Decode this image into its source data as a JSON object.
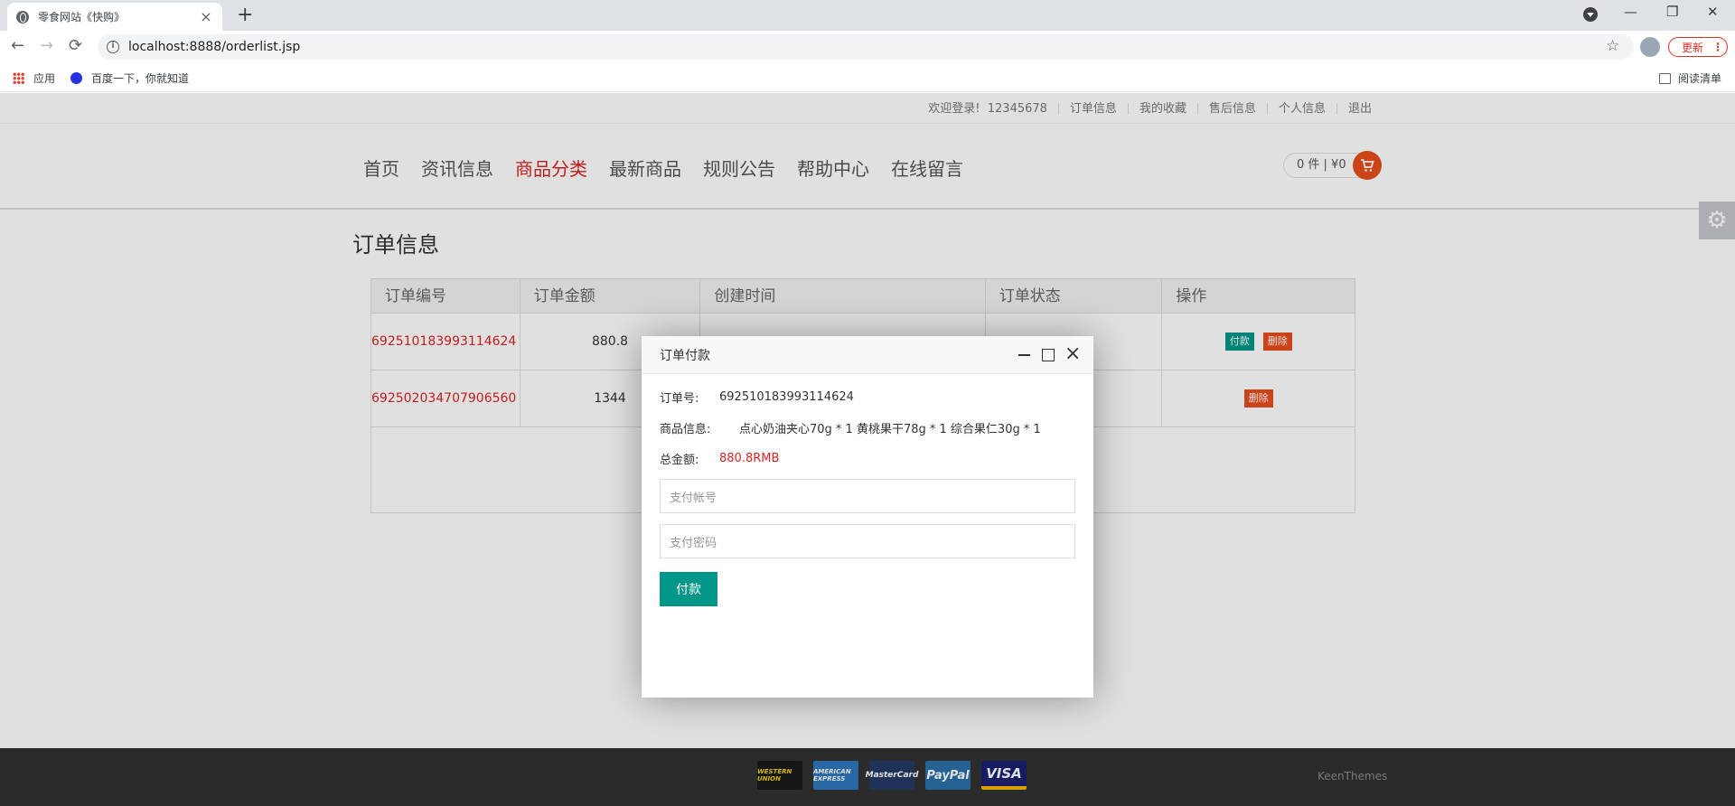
{
  "browser": {
    "tab_title": "零食网站《快购》",
    "tab_close": "×",
    "new_tab": "+",
    "url": "localhost:8888/orderlist.jsp",
    "update_label": "更新",
    "update_more": "⋮",
    "bookmarks": [
      "应用",
      "百度一下，你就知道"
    ],
    "reading_list": "阅读清单",
    "nav": {
      "back": "←",
      "forward": "→",
      "reload": "⟳",
      "star": "☆"
    },
    "window": {
      "minimize": "—",
      "restore": "❐",
      "close": "✕"
    }
  },
  "topbar": {
    "welcome": "欢迎登录!",
    "user": "12345678",
    "links": [
      "订单信息",
      "我的收藏",
      "售后信息",
      "个人信息",
      "退出"
    ]
  },
  "mainnav": {
    "items": [
      "首页",
      "资讯信息",
      "商品分类",
      "最新商品",
      "规则公告",
      "帮助中心",
      "在线留言"
    ],
    "active": "商品分类"
  },
  "cart": {
    "summary": "0 件 | ¥0",
    "icon": "cart-icon"
  },
  "content": {
    "title": "订单信息",
    "columns": [
      "订单编号",
      "订单金额",
      "创建时间",
      "订单状态",
      "操作"
    ],
    "rows": [
      {
        "id": "692510183993114624",
        "amount": "880.8",
        "actions": [
          "付款",
          "删除"
        ]
      },
      {
        "id": "692502034707906560",
        "amount": "1344",
        "actions": [
          "删除"
        ]
      }
    ]
  },
  "footer": {
    "payments": [
      "WESTERN UNION",
      "AMERICAN EXPRESS",
      "MasterCard",
      "PayPal",
      "VISA"
    ],
    "brand": "KeenThemes"
  },
  "modal": {
    "title": "订单付款",
    "order_label": "订单号:",
    "order_value": "692510183993114624",
    "goods_label": "商品信息:",
    "goods_value": "点心奶油夹心70g  * 1 黄桃果干78g  * 1 综合果仁30g  * 1",
    "total_label": "总金额:",
    "total_value": "880.8RMB",
    "account_placeholder": "支付帐号",
    "password_placeholder": "支付密码",
    "submit": "付款",
    "close": "×"
  },
  "colors": {
    "accent": "#e02222",
    "pay_green": "#009688",
    "delete_orange": "#e84d1c"
  }
}
